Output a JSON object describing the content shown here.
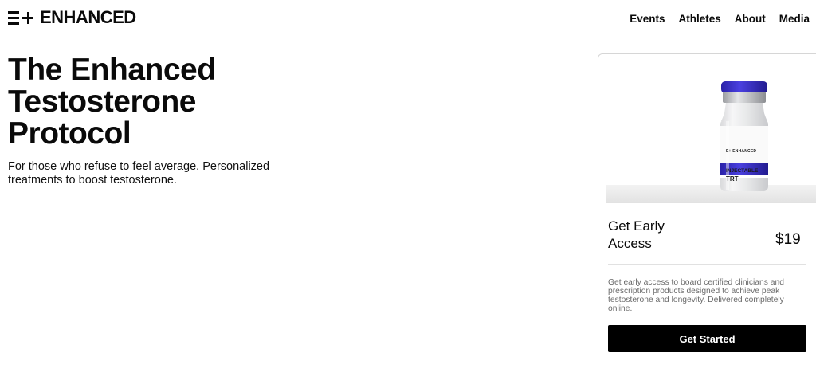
{
  "header": {
    "logo_text": "ENHANCED",
    "nav": [
      {
        "label": "Events"
      },
      {
        "label": "Athletes"
      },
      {
        "label": "About"
      },
      {
        "label": "Media"
      }
    ]
  },
  "hero": {
    "title": "The Enhanced Testosterone Protocol",
    "subtitle": "For those who refuse to feel average. Personalized treatments to boost testosterone."
  },
  "card": {
    "image": {
      "brand": "E+ ENHANCED",
      "label_line1": "INJECTABLE",
      "label_line2": "TRT",
      "accent_color": "#3b2fc9"
    },
    "title": "Get Early Access",
    "price": "$19",
    "description": "Get early access to board certified clinicians and prescription products designed to achieve peak testosterone and longevity. Delivered completely online.",
    "cta_label": "Get Started"
  }
}
